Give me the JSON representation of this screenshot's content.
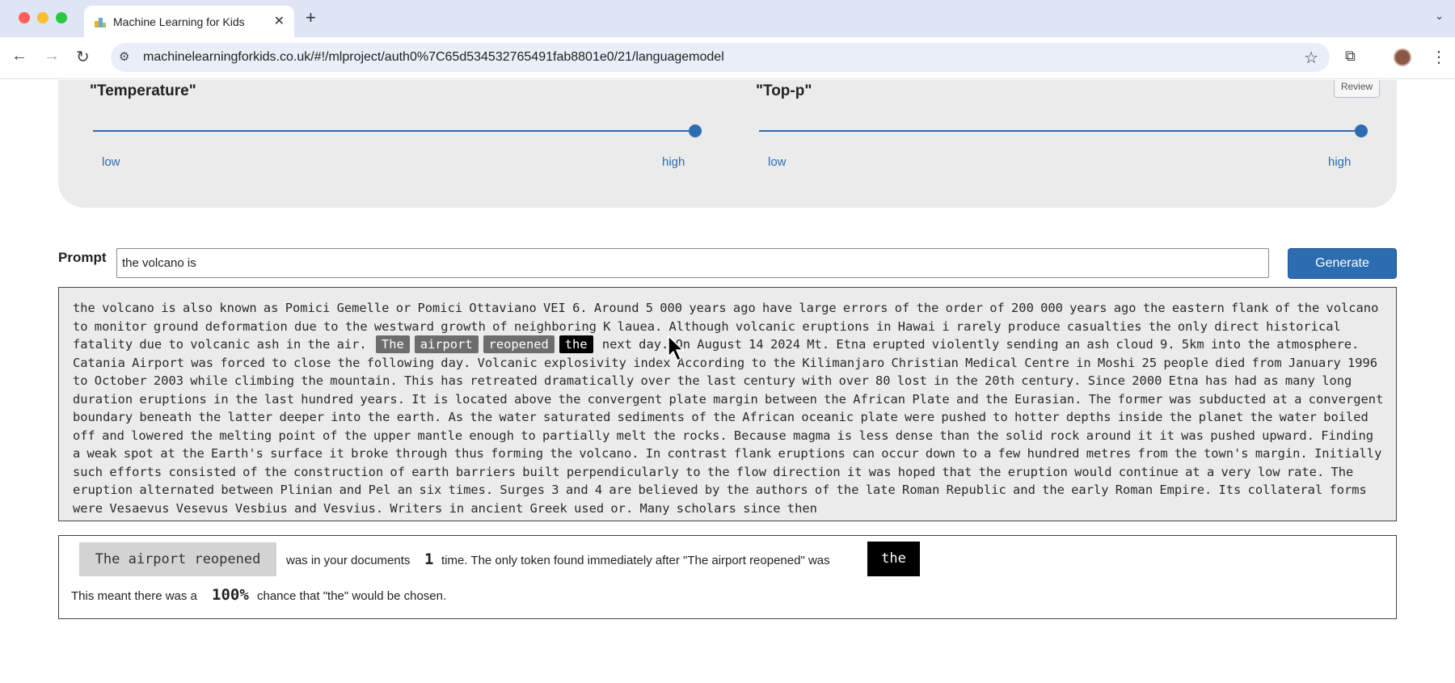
{
  "browser": {
    "tab_title": "Machine Learning for Kids",
    "tab_close_glyph": "✕",
    "new_tab_glyph": "+",
    "tab_menu_glyph": "⌄",
    "url": "machinelearningforkids.co.uk/#!/mlproject/auth0%7C65d534532765491fab8801e0/21/languagemodel",
    "back_glyph": "←",
    "forward_glyph": "→",
    "reload_glyph": "↻",
    "site_info_glyph": "⚙",
    "star_glyph": "☆",
    "extensions_glyph": "⧉",
    "menu_glyph": "⋮",
    "colors": {
      "tabbar": "#dee5f5",
      "omnibox": "#e9eef8"
    }
  },
  "settings": {
    "temperature": {
      "title": "\"Temperature\"",
      "low_label": "low",
      "high_label": "high",
      "value": 1.0
    },
    "top_p": {
      "title": "\"Top-p\"",
      "low_label": "low",
      "high_label": "high",
      "value": 1.0
    },
    "review_label": "Review"
  },
  "prompt": {
    "label": "Prompt",
    "value": "the volcano is",
    "generate_label": "Generate"
  },
  "output": {
    "text_before": "the volcano is also known as Pomici Gemelle or Pomici Ottaviano VEI 6. Around 5 000 years ago have large errors of the order of 200 000 years ago the eastern flank of the volcano to monitor ground deformation due to the westward growth of neighboring K lauea. Although volcanic eruptions in Hawai i rarely produce casualties the only direct historical fatality due to volcanic ash in the air.",
    "highlighted_tokens": [
      "The",
      "airport",
      "reopened"
    ],
    "selected_token": "the",
    "text_after": "next day. On August 14 2024 Mt. Etna erupted violently sending an ash cloud 9. 5km into the atmosphere. Catania Airport was forced to close the following day. Volcanic explosivity index According to the Kilimanjaro Christian Medical Centre in Moshi 25 people died from January 1996 to October 2003 while climbing the mountain. This has retreated dramatically over the last century with over 80 lost in the 20th century. Since 2000 Etna has had as many long duration eruptions in the last hundred years. It is located above the convergent plate margin between the African Plate and the Eurasian. The former was subducted at a convergent boundary beneath the latter deeper into the earth. As the water saturated sediments of the African oceanic plate were pushed to hotter depths inside the planet the water boiled off and lowered the melting point of the upper mantle enough to partially melt the rocks. Because magma is less dense than the solid rock around it it was pushed upward. Finding a weak spot at the Earth's surface it broke through thus forming the volcano. In contrast flank eruptions can occur down to a few hundred metres from the town's margin. Initially such efforts consisted of the construction of earth barriers built perpendicularly to the flow direction it was hoped that the eruption would continue at a very low rate. The eruption alternated between Plinian and Pel an six times. Surges 3 and 4 are believed by the authors of the late Roman Republic and the early Roman Empire. Its collateral forms were Vesaevus Vesevus Vesbius and Vesvius. Writers in ancient Greek used or. Many scholars since then"
  },
  "explanation": {
    "phrase": "The airport reopened",
    "text_1": "was in your documents",
    "count": "1",
    "text_2": "time. The only token found immediately after \"The airport reopened\" was",
    "next_token": "the",
    "text_3": "This meant there was a",
    "percent": "100%",
    "text_4": "chance that \"the\" would be chosen."
  },
  "colors": {
    "accent": "#2c6cb0",
    "panel_background": "#ebebeb",
    "token_highlight": "#6d6d6d",
    "token_selected": "#000000"
  }
}
